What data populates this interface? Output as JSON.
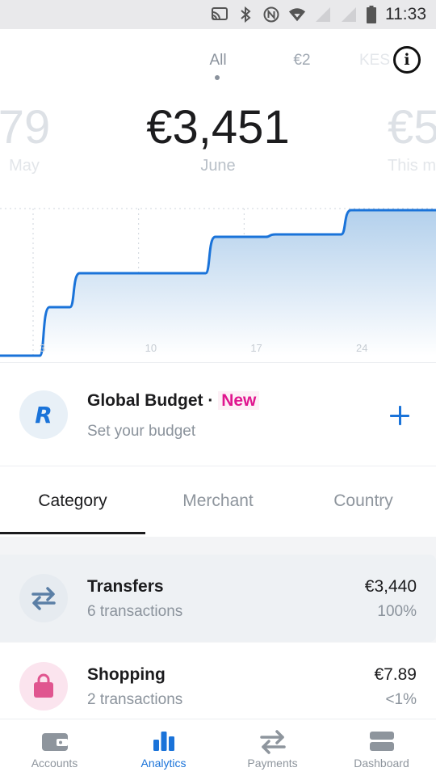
{
  "status_bar": {
    "time": "11:33",
    "icons": [
      "cast-icon",
      "bluetooth-icon",
      "nfc-icon",
      "wifi-icon",
      "signal-icon",
      "signal-icon",
      "battery-icon"
    ]
  },
  "currency_tabs": [
    {
      "label": "All",
      "active": true
    },
    {
      "label": "€2",
      "active": false
    },
    {
      "label": "KES",
      "active": false
    }
  ],
  "months": [
    {
      "amount": "79",
      "label": "May"
    },
    {
      "amount": "€3,451",
      "label": "June"
    },
    {
      "amount": "€5",
      "label": "This m"
    }
  ],
  "chart_data": {
    "type": "area",
    "x_ticks": [
      "3",
      "10",
      "17",
      "24"
    ],
    "series": [
      {
        "points": [
          [
            0,
            0
          ],
          [
            1,
            0
          ],
          [
            2,
            0
          ],
          [
            3,
            0
          ],
          [
            4,
            0.4
          ],
          [
            5,
            0.4
          ],
          [
            6,
            0.68
          ],
          [
            7,
            0.68
          ],
          [
            8,
            0.68
          ],
          [
            9,
            0.68
          ],
          [
            10,
            0.68
          ],
          [
            11,
            0.68
          ],
          [
            12,
            0.68
          ],
          [
            13,
            0.68
          ],
          [
            14,
            0.68
          ],
          [
            15,
            0.98
          ],
          [
            16,
            0.98
          ],
          [
            17,
            0.98
          ],
          [
            18,
            0.98
          ],
          [
            19,
            1.0
          ],
          [
            20,
            1.0
          ],
          [
            21,
            1.0
          ],
          [
            22,
            1.0
          ],
          [
            23,
            1.0
          ],
          [
            24,
            1.2
          ],
          [
            25,
            1.2
          ],
          [
            26,
            1.2
          ],
          [
            27,
            1.2
          ],
          [
            28,
            1.2
          ],
          [
            29,
            1.2
          ],
          [
            30,
            1.2
          ]
        ]
      }
    ],
    "colors": {
      "line": "#1a73d9",
      "fill_top": "#b3d0ec",
      "fill_bottom": "#ffffff"
    }
  },
  "budget": {
    "logo": "R",
    "title": "Global Budget",
    "separator": "·",
    "badge": "New",
    "subtitle": "Set your budget",
    "action_icon": "plus-icon"
  },
  "group_tabs": [
    {
      "label": "Category",
      "active": true
    },
    {
      "label": "Merchant",
      "active": false
    },
    {
      "label": "Country",
      "active": false
    }
  ],
  "categories": [
    {
      "name": "Transfers",
      "count": "6 transactions",
      "amount": "€3,440",
      "percent": "100%",
      "icon": "transfer-arrows-icon",
      "icon_bg": "#e6ebf0",
      "icon_color": "#5b7fa6"
    },
    {
      "name": "Shopping",
      "count": "2 transactions",
      "amount": "€7.89",
      "percent": "<1%",
      "icon": "shopping-bag-icon",
      "icon_bg": "#fbe4ee",
      "icon_color": "#e0558f"
    }
  ],
  "bottom_nav": [
    {
      "label": "Accounts",
      "icon": "wallet-icon",
      "active": false
    },
    {
      "label": "Analytics",
      "icon": "bar-chart-icon",
      "active": true
    },
    {
      "label": "Payments",
      "icon": "transfer-arrows-icon",
      "active": false
    },
    {
      "label": "Dashboard",
      "icon": "dashboard-icon",
      "active": false
    }
  ],
  "colors": {
    "accent": "#1a73d9",
    "badge_pink": "#e0168f"
  }
}
